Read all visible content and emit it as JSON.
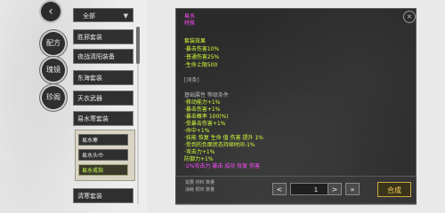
{
  "nav": {
    "back_icon": "back-arrow-icon",
    "tabs": [
      {
        "label": "配方"
      },
      {
        "label": "瑰镜"
      },
      {
        "label": "珍阁"
      }
    ]
  },
  "filter": {
    "selected": "全部",
    "arrow": "▼"
  },
  "recipe_list": [
    {
      "label": "胜邪套装"
    },
    {
      "label": "夜战清阳装备"
    },
    {
      "label": "东海套装"
    },
    {
      "label": "天衣武器"
    },
    {
      "label": "易水寒套装"
    }
  ],
  "sub_list": [
    {
      "label": "易水寒"
    },
    {
      "label": "易水头巾"
    },
    {
      "label": "易水戒指"
    }
  ],
  "last_list_item": {
    "label": "清寒套装"
  },
  "details": {
    "title": "易水",
    "subtitle": "特殊",
    "bonus_title": "套装效果",
    "bonus_lines": [
      "·暴击伤害10%",
      "·普通伤害25%",
      "·生命上限500"
    ],
    "separator_label": "[词条]",
    "stats_title": "基础属性 等级条件",
    "stats_lines": [
      "·移动能力+1%",
      "·暴击伤害+1%",
      "·暴击概率 100(%)",
      "·受暴击伤害+1%",
      "·命中+1%",
      "·技能 恢复 生命 值 伤害 提升 1%",
      "·受到的负面状态持续时间-1%",
      "·攻击力+1%",
      "防御力+1%",
      "·2%攻击力 暴击 成功 恢复 伤害"
    ],
    "hint_lines": [
      "需要 材料 数量",
      "消耗 铜币 数量"
    ]
  },
  "controls": {
    "minus": "<",
    "plus": ">",
    "quantity": "1",
    "max": "»",
    "craft": "合成",
    "close_icon": "close-icon"
  }
}
